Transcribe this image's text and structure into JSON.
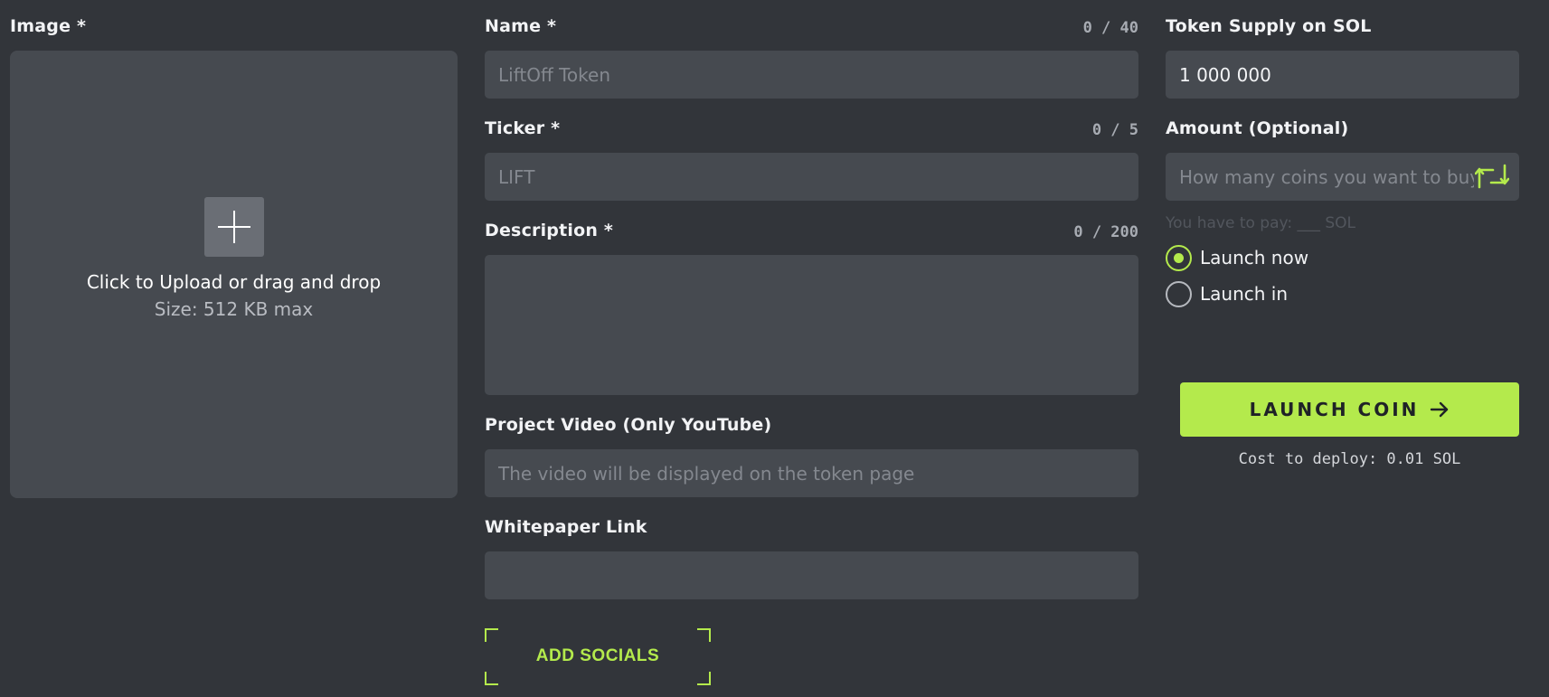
{
  "image": {
    "label": "Image *",
    "upload_title": "Click to Upload or drag and drop",
    "upload_size": "Size: 512 KB max",
    "icon": "plus-icon"
  },
  "name": {
    "label": "Name *",
    "counter": "0 / 40",
    "placeholder": "LiftOff Token",
    "value": ""
  },
  "ticker": {
    "label": "Ticker *",
    "counter": "0 / 5",
    "placeholder": "LIFT",
    "value": ""
  },
  "description": {
    "label": "Description *",
    "counter": "0 / 200",
    "placeholder": "",
    "value": ""
  },
  "video": {
    "label": "Project Video (Only YouTube)",
    "placeholder": "The video will be displayed on the token page",
    "value": ""
  },
  "whitepaper": {
    "label": "Whitepaper Link",
    "placeholder": "",
    "value": ""
  },
  "socials": {
    "label": "ADD SOCIALS"
  },
  "supply": {
    "label": "Token Supply on SOL",
    "value": "1 000 000"
  },
  "amount": {
    "label": "Amount (Optional)",
    "placeholder": "How many coins you want to buy",
    "value": "",
    "icon": "swap-icon",
    "pay_hint": "You have to pay: ___ SOL"
  },
  "launch_options": [
    {
      "label": "Launch now",
      "checked": true
    },
    {
      "label": "Launch in",
      "checked": false
    }
  ],
  "launch_button": {
    "label": "LAUNCH COIN",
    "icon": "arrow-right-icon"
  },
  "cost": "Cost to deploy: 0.01 SOL",
  "colors": {
    "background": "#32353a",
    "field": "#464a50",
    "accent": "#b4ea4c",
    "text": "#f2f3f5",
    "muted": "#a8acb3"
  }
}
